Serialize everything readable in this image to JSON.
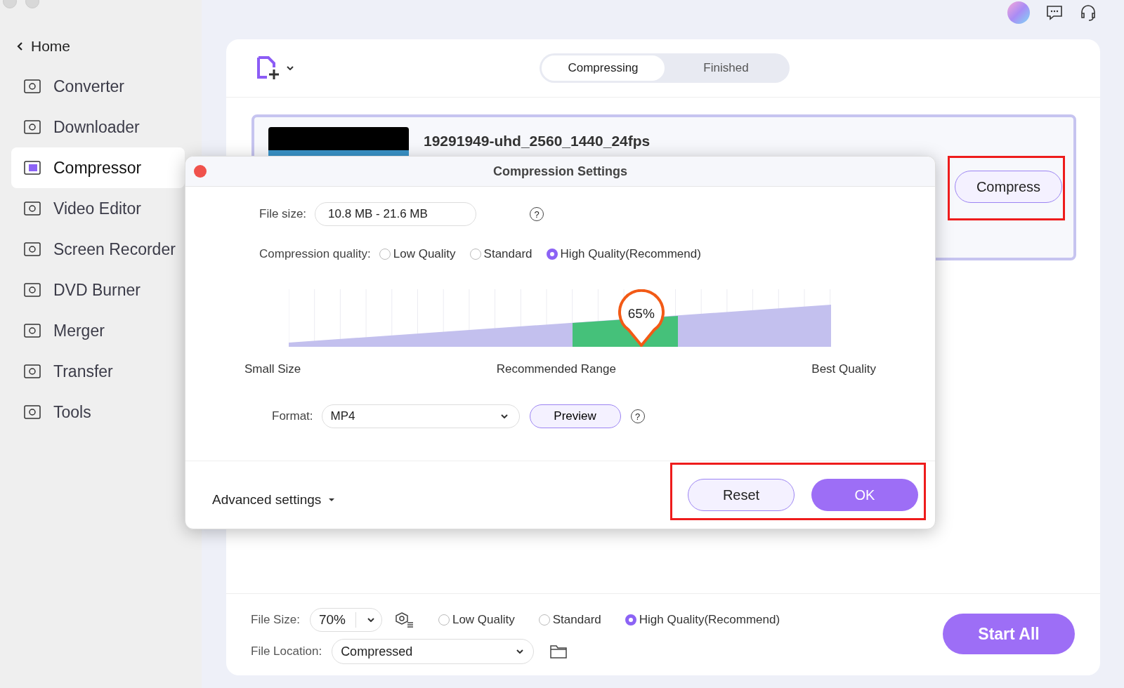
{
  "sidebar": {
    "back": "Home",
    "items": [
      {
        "label": "Converter",
        "selected": false
      },
      {
        "label": "Downloader",
        "selected": false
      },
      {
        "label": "Compressor",
        "selected": true
      },
      {
        "label": "Video Editor",
        "selected": false
      },
      {
        "label": "Screen Recorder",
        "selected": false
      },
      {
        "label": "DVD Burner",
        "selected": false
      },
      {
        "label": "Merger",
        "selected": false
      },
      {
        "label": "Transfer",
        "selected": false
      },
      {
        "label": "Tools",
        "selected": false
      }
    ]
  },
  "tabs": [
    {
      "label": "Compressing",
      "selected": true
    },
    {
      "label": "Finished",
      "selected": false
    }
  ],
  "file": {
    "name": "19291949-uhd_2560_1440_24fps",
    "compress_button": "Compress"
  },
  "dialog": {
    "title": "Compression Settings",
    "file_size": {
      "label": "File size:",
      "value": "10.8 MB - 21.6 MB"
    },
    "quality": {
      "label": "Compression quality:",
      "options": [
        {
          "label": "Low Quality",
          "selected": false
        },
        {
          "label": "Standard",
          "selected": false
        },
        {
          "label": "High Quality(Recommend)",
          "selected": true
        }
      ]
    },
    "slider": {
      "level": 0.65,
      "reading": "65%",
      "labels": [
        "Small Size",
        "Recommended Range",
        "Best Quality"
      ]
    },
    "format": {
      "label": "Format:",
      "value": "MP4",
      "preview": "Preview"
    },
    "advanced": "Advanced settings",
    "reset": "Reset",
    "ok": "OK",
    "help_icons": [
      "?",
      "?"
    ]
  },
  "bottom_bar": {
    "file_size": {
      "label": "File Size:",
      "value": "70%"
    },
    "quality_options": [
      {
        "label": "Low Quality",
        "selected": false
      },
      {
        "label": "Standard",
        "selected": false
      },
      {
        "label": "High Quality(Recommend)",
        "selected": true
      }
    ],
    "file_location": {
      "label": "File Location:",
      "value": "Compressed"
    },
    "start_all": "Start All"
  }
}
